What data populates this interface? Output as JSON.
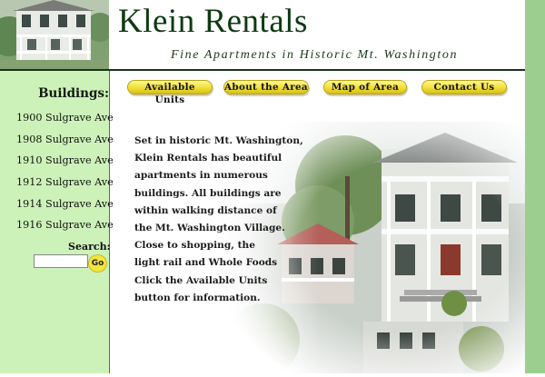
{
  "header": {
    "title": "Klein Rentals",
    "tagline": "Fine Apartments in Historic Mt. Washington"
  },
  "nav": {
    "items": [
      {
        "label": "Available Units"
      },
      {
        "label": "About the Area"
      },
      {
        "label": "Map of Area"
      },
      {
        "label": "Contact Us"
      }
    ]
  },
  "sidebar": {
    "heading": "Buildings:",
    "buildings": [
      {
        "label": "1900 Sulgrave Ave"
      },
      {
        "label": "1908 Sulgrave Ave"
      },
      {
        "label": "1910 Sulgrave Ave"
      },
      {
        "label": "1912 Sulgrave Ave"
      },
      {
        "label": "1914 Sulgrave Ave"
      },
      {
        "label": "1916 Sulgrave Ave"
      }
    ],
    "search": {
      "label": "Search:",
      "value": "",
      "button_label": "Go"
    }
  },
  "content": {
    "intro_lines": [
      "Set in historic Mt. Washington,",
      "Klein Rentals has beautiful",
      "apartments in numerous",
      "buildings.  All buildings are",
      "within walking distance of",
      "the Mt. Washington Village.",
      "Close to shopping, the",
      "light rail and Whole Foods",
      "Click the Available Units",
      "button for information."
    ]
  },
  "colors": {
    "sidebar_bg": "#cdf2b9",
    "right_stripe": "#9ccf8f",
    "brand_green": "#0e3a12",
    "button_yellow": "#f0df33"
  }
}
